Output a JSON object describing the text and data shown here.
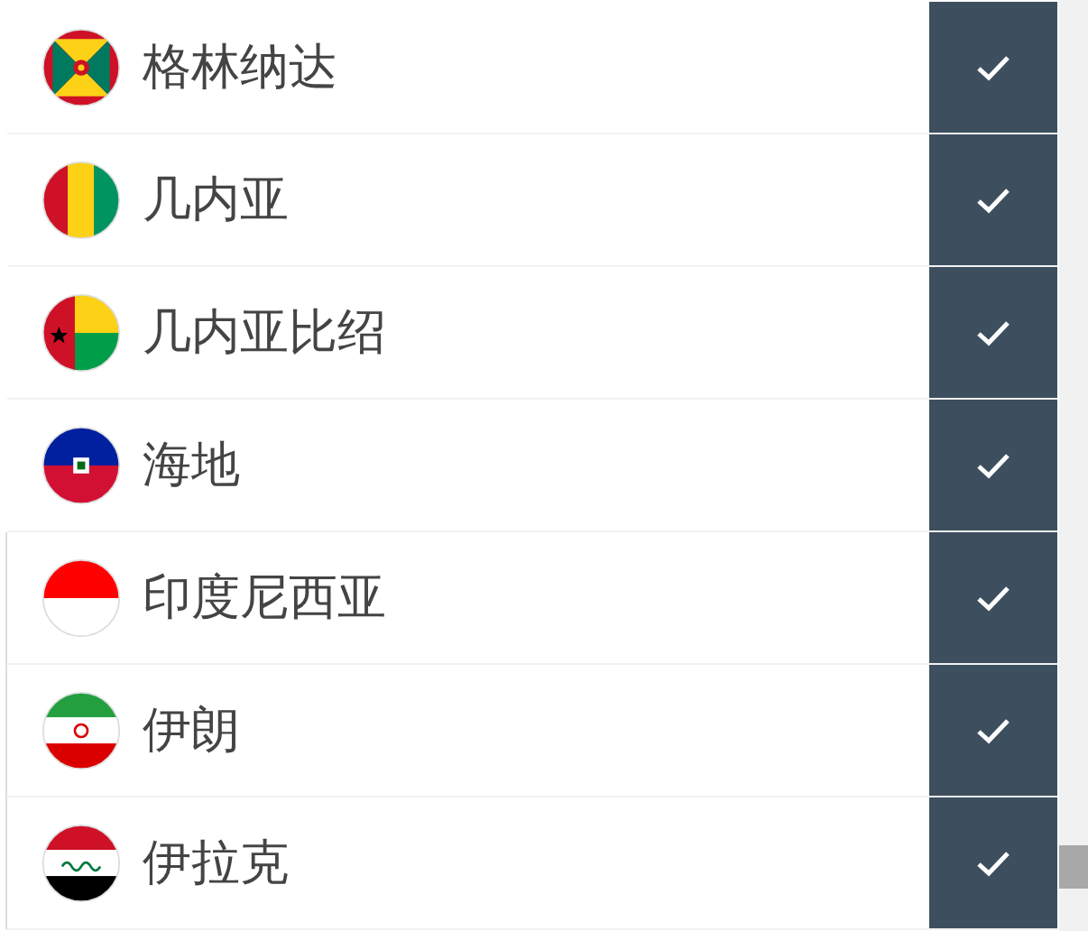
{
  "countries": [
    {
      "name": "格林纳达",
      "checked": true
    },
    {
      "name": "几内亚",
      "checked": true
    },
    {
      "name": "几内亚比绍",
      "checked": true
    },
    {
      "name": "海地",
      "checked": true
    },
    {
      "name": "印度尼西亚",
      "checked": true
    },
    {
      "name": "伊朗",
      "checked": true
    },
    {
      "name": "伊拉克",
      "checked": true
    }
  ]
}
